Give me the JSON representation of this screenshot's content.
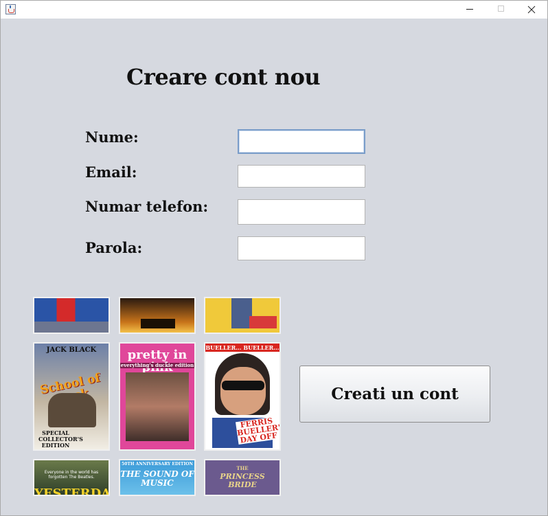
{
  "window": {
    "app_icon": "java-cup-icon",
    "controls": {
      "minimize": "minimize-icon",
      "maximize": "maximize-icon",
      "close": "close-icon"
    }
  },
  "form": {
    "title": "Creare cont nou",
    "fields": [
      {
        "label": "Nume:",
        "value": "",
        "focused": true
      },
      {
        "label": "Email:",
        "value": ""
      },
      {
        "label": "Numar telefon:",
        "value": ""
      },
      {
        "label": "Parola:",
        "value": ""
      }
    ],
    "submit_label": "Creati un cont"
  },
  "posters": {
    "top_row_partial": [
      "",
      "",
      ""
    ],
    "middle_row": [
      {
        "top": "JACK BLACK",
        "title": "School of Rock",
        "bottom": "SPECIAL COLLECTOR'S EDITION"
      },
      {
        "top": "",
        "title": "pretty in pink",
        "bottom": "everything's duckie edition"
      },
      {
        "top": "BUELLER... BUELLER... EDITION",
        "title": "FERRIS BUELLER'S DAY OFF",
        "bottom": ""
      }
    ],
    "bottom_row": [
      {
        "top": "Everyone in the world has forgotten The Beatles.",
        "title": "YESTERDAY"
      },
      {
        "top": "50TH ANNIVERSARY EDITION",
        "title": "THE SOUND OF MUSIC"
      },
      {
        "top": "THE",
        "title": "PRINCESS BRIDE"
      }
    ]
  }
}
